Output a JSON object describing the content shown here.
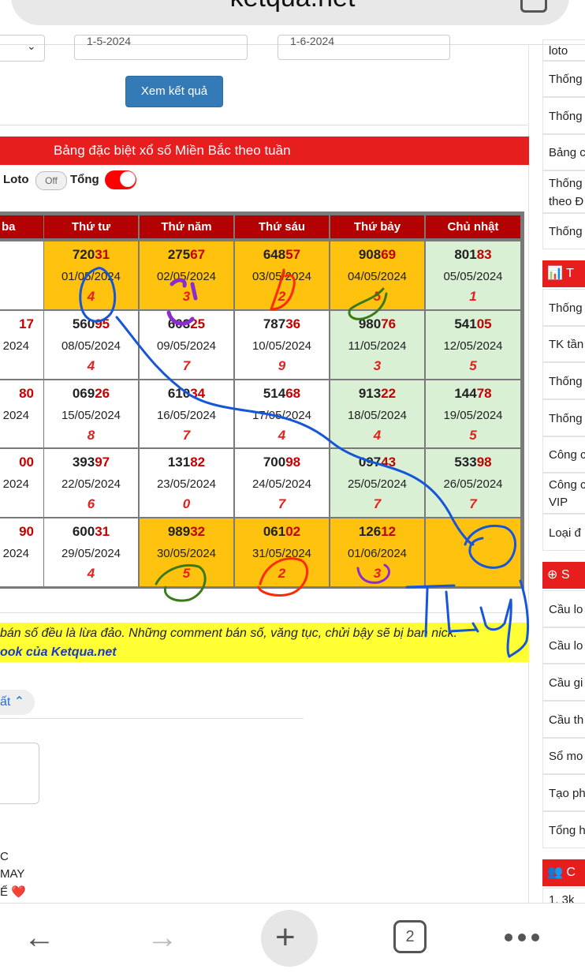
{
  "browser": {
    "url": "ketqua.net",
    "tab_count": "2"
  },
  "form": {
    "start_date": "1-5-2024",
    "end_date": "1-6-2024",
    "submit_label": "Xem kết quả"
  },
  "title_bar": "Bảng đặc biệt xổ số Miền Bắc theo tuần",
  "toggles": {
    "loto_label": "Loto",
    "loto_state": "Off",
    "tong_label": "Tổng"
  },
  "table": {
    "headers": [
      "ba",
      "Thứ tư",
      "Thứ năm",
      "Thứ sáu",
      "Thứ bảy",
      "Chủ nhật"
    ],
    "rows": [
      [
        {
          "head": "",
          "tail": "",
          "date": "",
          "total": "",
          "color": "white"
        },
        {
          "head": "720",
          "tail": "31",
          "date": "01/05/2024",
          "total": "4",
          "color": "orange"
        },
        {
          "head": "275",
          "tail": "67",
          "date": "02/05/2024",
          "total": "3",
          "color": "orange"
        },
        {
          "head": "648",
          "tail": "57",
          "date": "03/05/2024",
          "total": "2",
          "color": "orange"
        },
        {
          "head": "908",
          "tail": "69",
          "date": "04/05/2024",
          "total": "5",
          "color": "orange"
        },
        {
          "head": "801",
          "tail": "83",
          "date": "05/05/2024",
          "total": "1",
          "color": "green"
        }
      ],
      [
        {
          "head": "",
          "tail": "17",
          "date": "2024",
          "total": "",
          "color": "white"
        },
        {
          "head": "560",
          "tail": "95",
          "date": "08/05/2024",
          "total": "4",
          "color": "white"
        },
        {
          "head": "603",
          "tail": "25",
          "date": "09/05/2024",
          "total": "7",
          "color": "white"
        },
        {
          "head": "787",
          "tail": "36",
          "date": "10/05/2024",
          "total": "9",
          "color": "white"
        },
        {
          "head": "980",
          "tail": "76",
          "date": "11/05/2024",
          "total": "3",
          "color": "green"
        },
        {
          "head": "541",
          "tail": "05",
          "date": "12/05/2024",
          "total": "5",
          "color": "green"
        }
      ],
      [
        {
          "head": "",
          "tail": "80",
          "date": "2024",
          "total": "",
          "color": "white"
        },
        {
          "head": "069",
          "tail": "26",
          "date": "15/05/2024",
          "total": "8",
          "color": "white"
        },
        {
          "head": "610",
          "tail": "34",
          "date": "16/05/2024",
          "total": "7",
          "color": "white"
        },
        {
          "head": "514",
          "tail": "68",
          "date": "17/05/2024",
          "total": "4",
          "color": "white"
        },
        {
          "head": "913",
          "tail": "22",
          "date": "18/05/2024",
          "total": "4",
          "color": "green"
        },
        {
          "head": "144",
          "tail": "78",
          "date": "19/05/2024",
          "total": "5",
          "color": "green"
        }
      ],
      [
        {
          "head": "",
          "tail": "00",
          "date": "2024",
          "total": "",
          "color": "white"
        },
        {
          "head": "393",
          "tail": "97",
          "date": "22/05/2024",
          "total": "6",
          "color": "white"
        },
        {
          "head": "131",
          "tail": "82",
          "date": "23/05/2024",
          "total": "0",
          "color": "white"
        },
        {
          "head": "700",
          "tail": "98",
          "date": "24/05/2024",
          "total": "7",
          "color": "white"
        },
        {
          "head": "097",
          "tail": "43",
          "date": "25/05/2024",
          "total": "7",
          "color": "green"
        },
        {
          "head": "533",
          "tail": "98",
          "date": "26/05/2024",
          "total": "7",
          "color": "green"
        }
      ],
      [
        {
          "head": "",
          "tail": "90",
          "date": "2024",
          "total": "",
          "color": "white"
        },
        {
          "head": "600",
          "tail": "31",
          "date": "29/05/2024",
          "total": "4",
          "color": "white"
        },
        {
          "head": "989",
          "tail": "32",
          "date": "30/05/2024",
          "total": "5",
          "color": "orange"
        },
        {
          "head": "061",
          "tail": "02",
          "date": "31/05/2024",
          "total": "2",
          "color": "orange"
        },
        {
          "head": "126",
          "tail": "12",
          "date": "01/06/2024",
          "total": "3",
          "color": "orange"
        },
        {
          "head": "",
          "tail": "",
          "date": "",
          "total": "",
          "color": "orange"
        }
      ]
    ]
  },
  "notice": {
    "line1": "bán số đều là lừa đảo. Những comment bán số, văng tục, chửi bậy sẽ bị ban nick.",
    "line2": "ook của Ketqua.net"
  },
  "comments": {
    "sort_label": "ất",
    "lines": [
      "C",
      "MAY",
      "Ế"
    ]
  },
  "sidebar": {
    "rows1": [
      "loto",
      "Thống",
      "Thống",
      "Bảng c",
      "Thống theo Đ",
      "Thống"
    ],
    "head1": "T",
    "rows2": [
      "Thống",
      "TK tần",
      "Thống",
      "Thống",
      "Công c",
      "Công c VIP",
      "Loại đ"
    ],
    "head2": "S",
    "rows3": [
      "Cầu lo",
      "Cầu lo",
      "Cầu gi",
      "Cầu th",
      "Sổ mo",
      "Tạo ph",
      "Tổng h"
    ],
    "head3": "C",
    "last_row": "1. 3k"
  },
  "annotations": {
    "handwriting": "TLY",
    "colors": {
      "blue": "#1656d8",
      "orange": "#ff2a00",
      "green": "#3a7a1a",
      "purple": "#8a2ccf"
    }
  }
}
